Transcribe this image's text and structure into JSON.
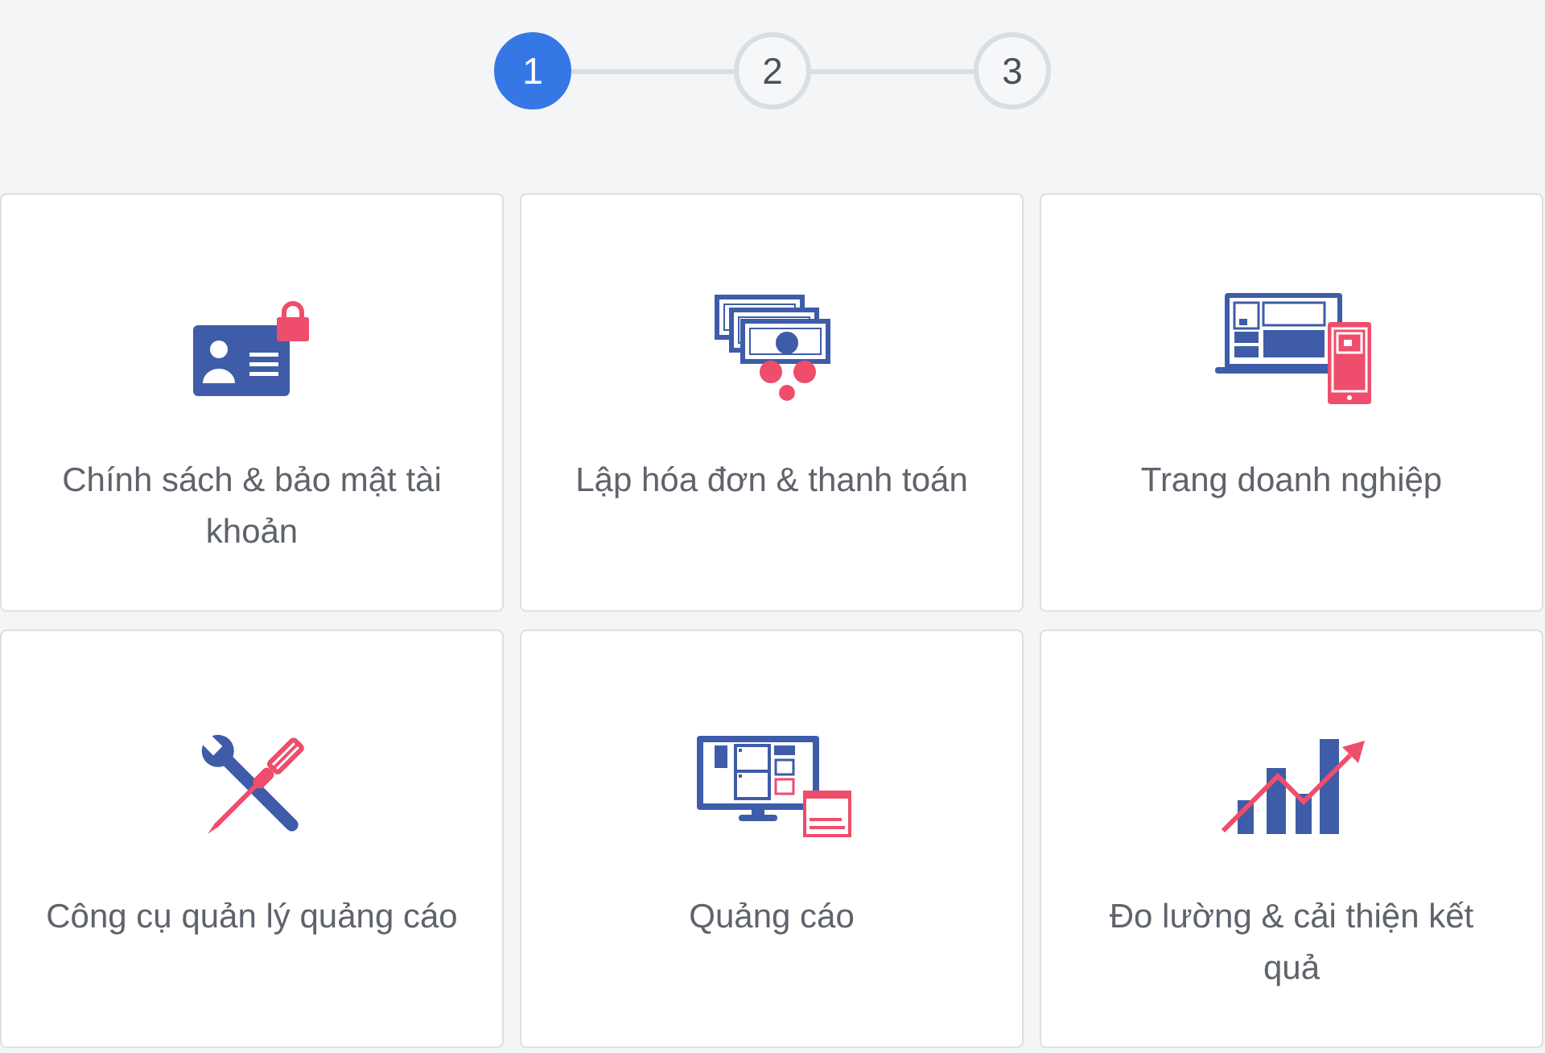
{
  "steps": [
    {
      "label": "1",
      "selected": true
    },
    {
      "label": "2",
      "selected": false
    },
    {
      "label": "3",
      "selected": false
    }
  ],
  "topics": [
    {
      "kind": "account",
      "label": "Chính sách & bảo mật tài khoản"
    },
    {
      "kind": "billing",
      "label": "Lập hóa đơn & thanh toán"
    },
    {
      "kind": "page",
      "label": "Trang doanh nghiệp"
    },
    {
      "kind": "tools",
      "label": "Công cụ quản lý quảng cáo"
    },
    {
      "kind": "ads",
      "label": "Quảng cáo"
    },
    {
      "kind": "measure",
      "label": "Đo lường & cải thiện kết quả"
    }
  ]
}
